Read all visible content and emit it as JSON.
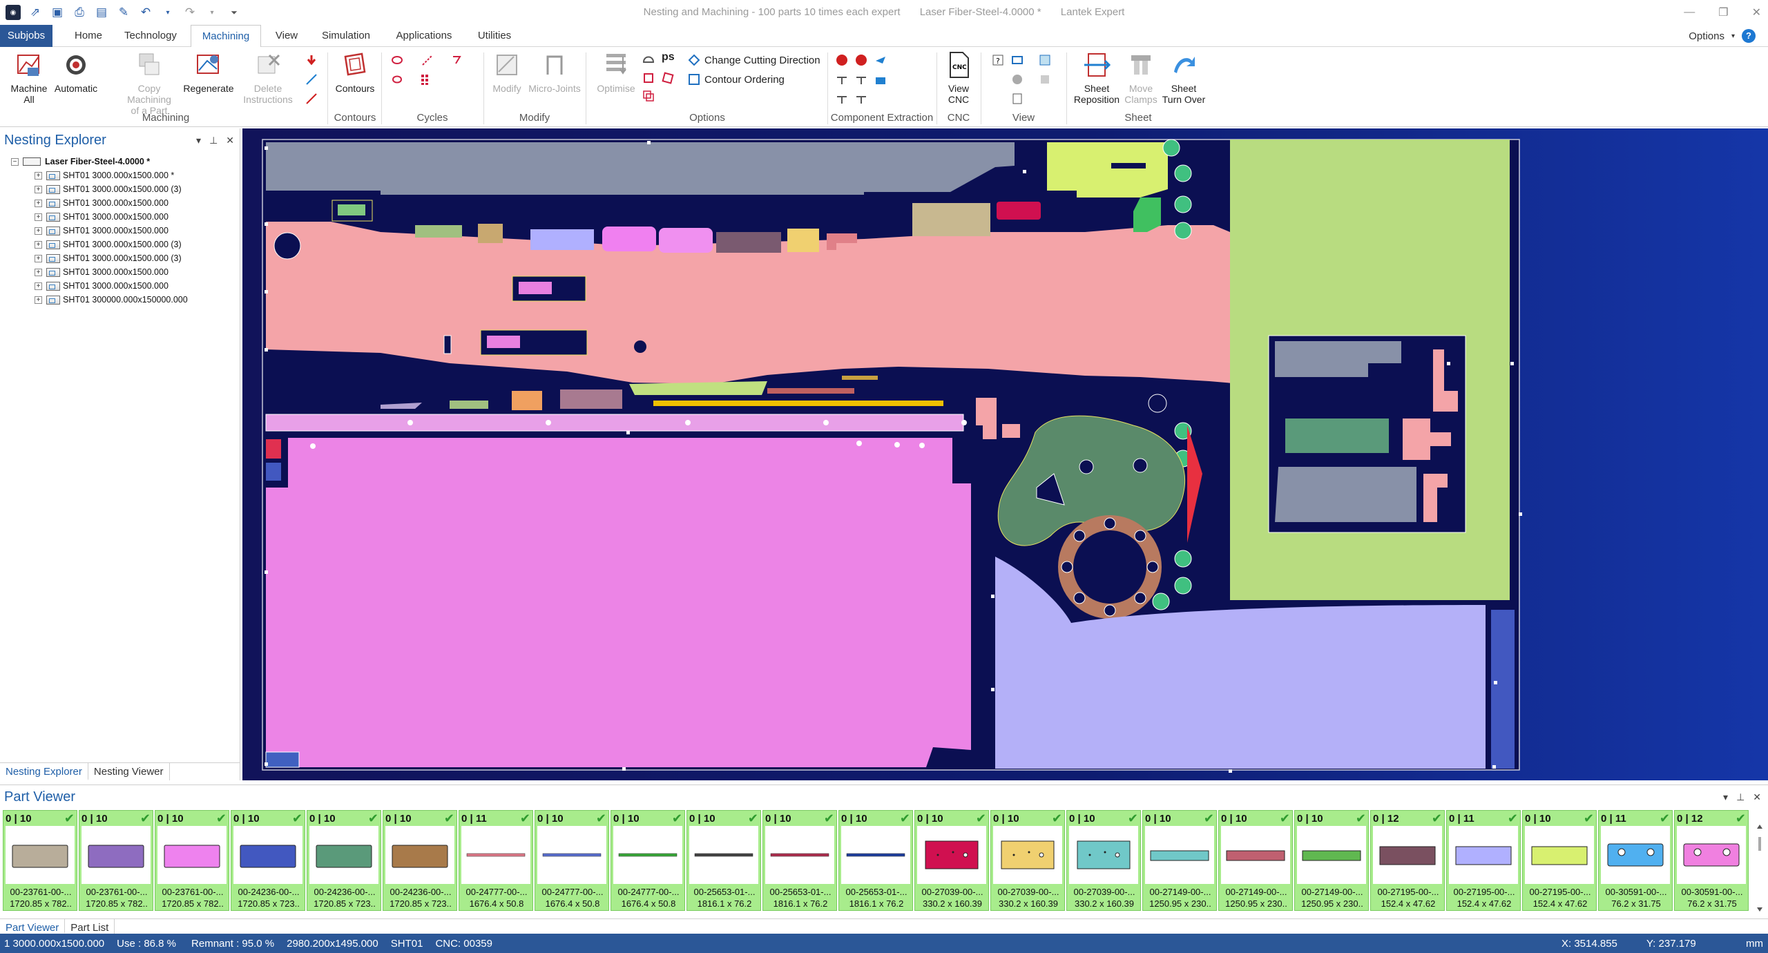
{
  "title": {
    "left": "Nesting and Machining - 100 parts 10 times each expert",
    "middle": "Laser Fiber-Steel-4.0000 *",
    "right": "Lantek Expert"
  },
  "tabs": [
    "Subjobs",
    "Home",
    "Technology",
    "Machining",
    "View",
    "Simulation",
    "Applications",
    "Utilities"
  ],
  "options_label": "Options",
  "ribbon": {
    "machine_all": [
      "Machine",
      "All"
    ],
    "automatic": "Automatic",
    "copy_machining": [
      "Copy Machining",
      "of a Part"
    ],
    "regenerate": "Regenerate",
    "delete_instr": [
      "Delete",
      "Instructions"
    ],
    "contours": "Contours",
    "modify": "Modify",
    "micro_joints": "Micro-Joints",
    "optimise": "Optimise",
    "change_dir": "Change Cutting Direction",
    "contour_order": "Contour Ordering",
    "view_cnc": [
      "View",
      "CNC"
    ],
    "sheet_repos": [
      "Sheet",
      "Reposition"
    ],
    "move_clamps": [
      "Move",
      "Clamps"
    ],
    "sheet_turn": [
      "Sheet",
      "Turn Over"
    ],
    "groups": {
      "machining": "Machining",
      "contours": "Contours",
      "cycles": "Cycles",
      "modify": "Modify",
      "options": "Options",
      "component": "Component Extraction",
      "cnc": "CNC",
      "view": "View",
      "sheet": "Sheet"
    }
  },
  "nesting_explorer": {
    "title": "Nesting Explorer",
    "root": "Laser Fiber-Steel-4.0000 *",
    "items": [
      "SHT01 3000.000x1500.000 *",
      "SHT01 3000.000x1500.000 (3)",
      "SHT01 3000.000x1500.000",
      "SHT01 3000.000x1500.000",
      "SHT01 3000.000x1500.000",
      "SHT01 3000.000x1500.000 (3)",
      "SHT01 3000.000x1500.000 (3)",
      "SHT01 3000.000x1500.000",
      "SHT01 3000.000x1500.000",
      "SHT01 300000.000x150000.000"
    ],
    "tabs": [
      "Nesting Explorer",
      "Nesting Viewer"
    ]
  },
  "part_viewer": {
    "title": "Part Viewer",
    "tabs": [
      "Part Viewer",
      "Part List"
    ],
    "cards": [
      {
        "count": "0 | 10",
        "name": "00-23761-00-...",
        "dim": "1720.85 x 782..",
        "color": "#b8ad9a",
        "shape": "rect"
      },
      {
        "count": "0 | 10",
        "name": "00-23761-00-...",
        "dim": "1720.85 x 782..",
        "color": "#8e6cc0",
        "shape": "rect"
      },
      {
        "count": "0 | 10",
        "name": "00-23761-00-...",
        "dim": "1720.85 x 782..",
        "color": "#ee82ee",
        "shape": "rect"
      },
      {
        "count": "0 | 10",
        "name": "00-24236-00-...",
        "dim": "1720.85 x 723..",
        "color": "#4258c0",
        "shape": "rect"
      },
      {
        "count": "0 | 10",
        "name": "00-24236-00-...",
        "dim": "1720.85 x 723..",
        "color": "#5a9a7a",
        "shape": "rect"
      },
      {
        "count": "0 | 10",
        "name": "00-24236-00-...",
        "dim": "1720.85 x 723..",
        "color": "#a87a4a",
        "shape": "rect"
      },
      {
        "count": "0 | 11",
        "name": "00-24777-00-...",
        "dim": "1676.4 x 50.8",
        "color": "#e07a8a",
        "shape": "line"
      },
      {
        "count": "0 | 10",
        "name": "00-24777-00-...",
        "dim": "1676.4 x 50.8",
        "color": "#5a70d0",
        "shape": "line"
      },
      {
        "count": "0 | 10",
        "name": "00-24777-00-...",
        "dim": "1676.4 x 50.8",
        "color": "#3aaa3a",
        "shape": "line"
      },
      {
        "count": "0 | 10",
        "name": "00-25653-01-...",
        "dim": "1816.1 x 76.2",
        "color": "#444444",
        "shape": "line"
      },
      {
        "count": "0 | 10",
        "name": "00-25653-01-...",
        "dim": "1816.1 x 76.2",
        "color": "#b03050",
        "shape": "line"
      },
      {
        "count": "0 | 10",
        "name": "00-25653-01-...",
        "dim": "1816.1 x 76.2",
        "color": "#2040a0",
        "shape": "line"
      },
      {
        "count": "0 | 10",
        "name": "00-27039-00-...",
        "dim": "330.2 x 160.39",
        "color": "#d01050",
        "shape": "plate"
      },
      {
        "count": "0 | 10",
        "name": "00-27039-00-...",
        "dim": "330.2 x 160.39",
        "color": "#f0d070",
        "shape": "plate"
      },
      {
        "count": "0 | 10",
        "name": "00-27039-00-...",
        "dim": "330.2 x 160.39",
        "color": "#70c8c8",
        "shape": "plate"
      },
      {
        "count": "0 | 10",
        "name": "00-27149-00-...",
        "dim": "1250.95 x 230..",
        "color": "#70c8c8",
        "shape": "thin"
      },
      {
        "count": "0 | 10",
        "name": "00-27149-00-...",
        "dim": "1250.95 x 230..",
        "color": "#c06070",
        "shape": "thin"
      },
      {
        "count": "0 | 10",
        "name": "00-27149-00-...",
        "dim": "1250.95 x 230..",
        "color": "#60b850",
        "shape": "thin"
      },
      {
        "count": "0 | 12",
        "name": "00-27195-00-...",
        "dim": "152.4 x 47.62",
        "color": "#7a5060",
        "shape": "mid"
      },
      {
        "count": "0 | 11",
        "name": "00-27195-00-...",
        "dim": "152.4 x 47.62",
        "color": "#b0b0ff",
        "shape": "mid"
      },
      {
        "count": "0 | 10",
        "name": "00-27195-00-...",
        "dim": "152.4 x 47.62",
        "color": "#d8f070",
        "shape": "mid"
      },
      {
        "count": "0 | 11",
        "name": "00-30591-00-...",
        "dim": "76.2 x 31.75",
        "color": "#50b0f0",
        "shape": "holes"
      },
      {
        "count": "0 | 12",
        "name": "00-30591-00-...",
        "dim": "76.2 x 31.75",
        "color": "#f080e0",
        "shape": "holes"
      }
    ]
  },
  "status": {
    "left": "1  3000.000x1500.000",
    "use": "Use : 86.8 %",
    "remnant": "Remnant : 95.0 %",
    "dims": "2980.200x1495.000",
    "sheet": "SHT01",
    "cnc": "CNC: 00359",
    "x": "X: 3514.855",
    "y": "Y: 237.179",
    "units": "mm"
  },
  "colors": {
    "accent": "#2b5797",
    "active_tab": "#1f5fa8",
    "card_bg": "#a8ec8c",
    "canvas_bg": "#11135a"
  }
}
